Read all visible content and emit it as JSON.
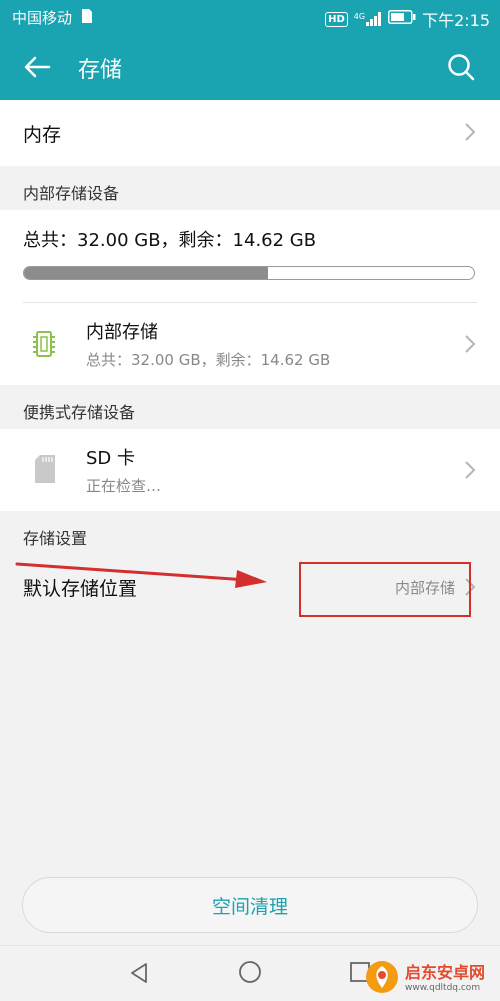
{
  "status_bar": {
    "carrier": "中国移动",
    "hd": "HD",
    "network": "4G",
    "time": "下午2:15"
  },
  "app_bar": {
    "title": "存储"
  },
  "memory": {
    "label": "内存"
  },
  "internal_section": {
    "header": "内部存储设备",
    "summary": "总共：32.00 GB，剩余：14.62 GB",
    "used_fraction": 0.543,
    "item": {
      "title": "内部存储",
      "subtitle": "总共：32.00 GB，剩余：14.62 GB"
    }
  },
  "portable_section": {
    "header": "便携式存储设备",
    "item": {
      "title": "SD 卡",
      "subtitle": "正在检查…"
    }
  },
  "settings_section": {
    "header": "存储设置",
    "default_location": {
      "label": "默认存储位置",
      "value": "内部存储"
    }
  },
  "clean_button": {
    "label": "空间清理"
  },
  "watermark": {
    "title": "启东安卓网",
    "url": "www.qdltdq.com"
  },
  "colors": {
    "accent": "#1aa3b1",
    "annotation": "#d32f2f"
  }
}
